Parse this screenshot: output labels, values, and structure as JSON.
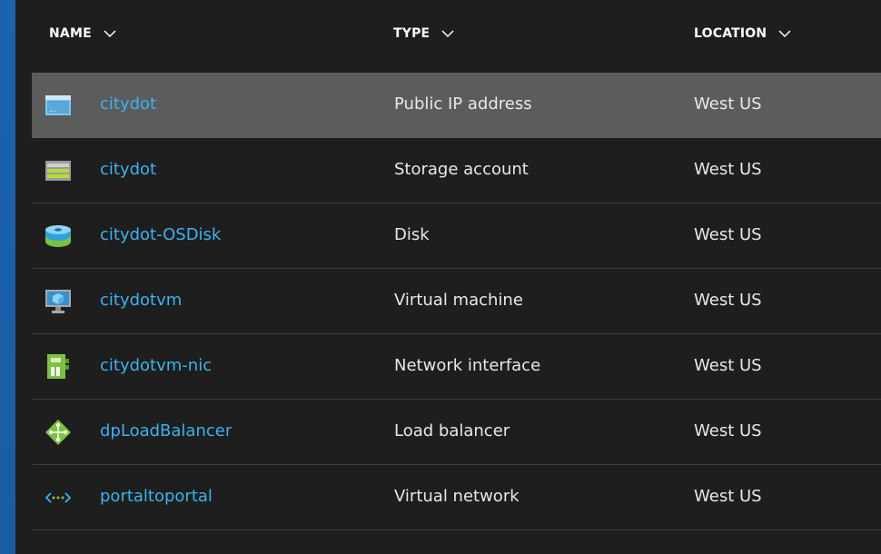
{
  "columns": {
    "name": "NAME",
    "type": "TYPE",
    "location": "LOCATION"
  },
  "colors": {
    "link": "#3cb2ee",
    "selected_row": "#5c5c5c",
    "panel_bg": "#1e1e1e",
    "frame_bg": "#1a5fa8"
  },
  "rows": [
    {
      "icon": "public-ip-icon",
      "name": "citydot",
      "type": "Public IP address",
      "location": "West US",
      "selected": true
    },
    {
      "icon": "storage-account-icon",
      "name": "citydot",
      "type": "Storage account",
      "location": "West US",
      "selected": false
    },
    {
      "icon": "disk-icon",
      "name": "citydot-OSDisk",
      "type": "Disk",
      "location": "West US",
      "selected": false
    },
    {
      "icon": "virtual-machine-icon",
      "name": "citydotvm",
      "type": "Virtual machine",
      "location": "West US",
      "selected": false
    },
    {
      "icon": "network-interface-icon",
      "name": "citydotvm-nic",
      "type": "Network interface",
      "location": "West US",
      "selected": false
    },
    {
      "icon": "load-balancer-icon",
      "name": "dpLoadBalancer",
      "type": "Load balancer",
      "location": "West US",
      "selected": false
    },
    {
      "icon": "virtual-network-icon",
      "name": "portaltoportal",
      "type": "Virtual network",
      "location": "West US",
      "selected": false
    }
  ]
}
